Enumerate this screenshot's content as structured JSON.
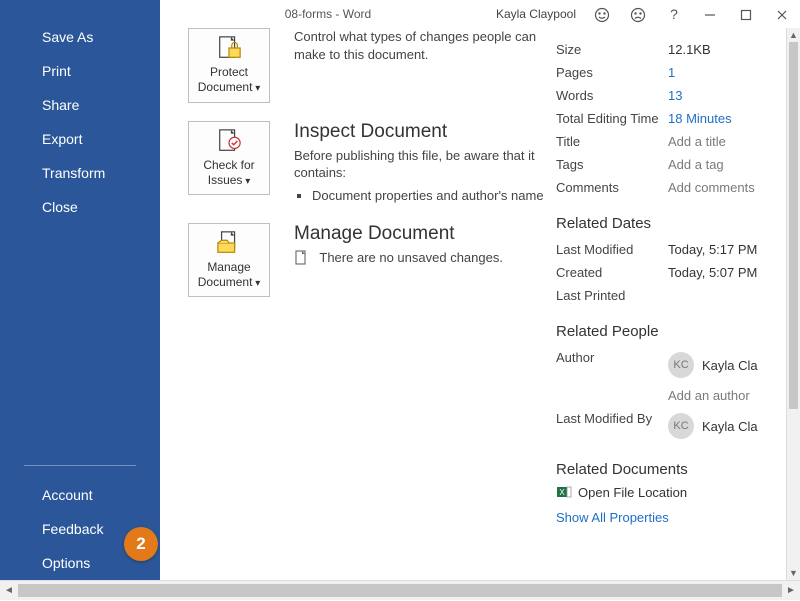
{
  "titlebar": {
    "title": "08-forms - Word",
    "user": "Kayla Claypool"
  },
  "sidebar": {
    "items": [
      "Save As",
      "Print",
      "Share",
      "Export",
      "Transform",
      "Close"
    ],
    "bottom": [
      "Account",
      "Feedback",
      "Options"
    ]
  },
  "sections": {
    "protect": {
      "btn": "Protect Document",
      "desc": "Control what types of changes people can make to this document."
    },
    "inspect": {
      "title": "Inspect Document",
      "btn": "Check for Issues",
      "desc": "Before publishing this file, be aware that it contains:",
      "bullet1": "Document properties and author's name"
    },
    "manage": {
      "title": "Manage Document",
      "btn": "Manage Document",
      "desc": "There are no unsaved changes."
    }
  },
  "props": {
    "size_k": "Size",
    "size_v": "12.1KB",
    "pages_k": "Pages",
    "pages_v": "1",
    "words_k": "Words",
    "words_v": "13",
    "edit_k": "Total Editing Time",
    "edit_v": "18 Minutes",
    "title_k": "Title",
    "title_v": "Add a title",
    "tags_k": "Tags",
    "tags_v": "Add a tag",
    "comments_k": "Comments",
    "comments_v": "Add comments",
    "dates_h": "Related Dates",
    "mod_k": "Last Modified",
    "mod_v": "Today, 5:17 PM",
    "created_k": "Created",
    "created_v": "Today, 5:07 PM",
    "printed_k": "Last Printed",
    "people_h": "Related People",
    "author_k": "Author",
    "author_v": "Kayla Cla",
    "author_initials": "KC",
    "addauthor": "Add an author",
    "lmb_k": "Last Modified By",
    "lmb_v": "Kayla Cla",
    "lmb_initials": "KC",
    "docs_h": "Related Documents",
    "openloc": "Open File Location",
    "showall": "Show All Properties"
  },
  "callouts": {
    "c2": "2"
  }
}
